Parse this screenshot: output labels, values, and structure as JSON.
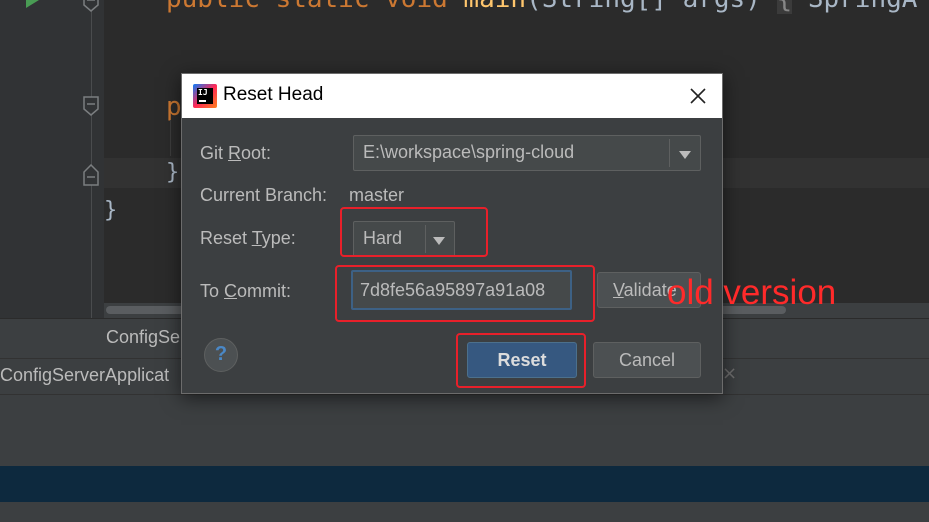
{
  "editor": {
    "line1": {
      "kw": "public static void",
      "fn": "main",
      "args": "(String[] args)",
      "fold": "{",
      "rest": "SpringA"
    },
    "line2_kw": "p",
    "line3": "}",
    "line4": "}"
  },
  "bottom_panel": {
    "tab_label": "ConfigSer",
    "run_label": "ConfigServerApplicat",
    "close_glyph": "×"
  },
  "dialog": {
    "title": "Reset Head",
    "close_glyph": "✕",
    "git_root": {
      "label_pre": "Git ",
      "label_mnemonic": "R",
      "label_post": "oot:",
      "value": "E:\\workspace\\spring-cloud"
    },
    "current_branch": {
      "label": "Current Branch:",
      "value": "master"
    },
    "reset_type": {
      "label_pre": "Reset ",
      "label_mnemonic": "T",
      "label_post": "ype:",
      "value": "Hard"
    },
    "to_commit": {
      "label_pre": "To ",
      "label_mnemonic": "C",
      "label_post": "ommit:",
      "value": "7d8fe56a95897a91a08"
    },
    "validate_button": {
      "pre": "",
      "mnemonic": "V",
      "post": "alidate"
    },
    "help_glyph": "?",
    "reset_button": "Reset",
    "cancel_button": "Cancel"
  },
  "annotation": {
    "text": "old version",
    "color": "#ff2a2a"
  },
  "colors": {
    "editor_bg": "#2b2b2b",
    "dialog_bg": "#3c3f41",
    "primary_button": "#365880",
    "keyword": "#cc7832",
    "function": "#ffc66d"
  }
}
